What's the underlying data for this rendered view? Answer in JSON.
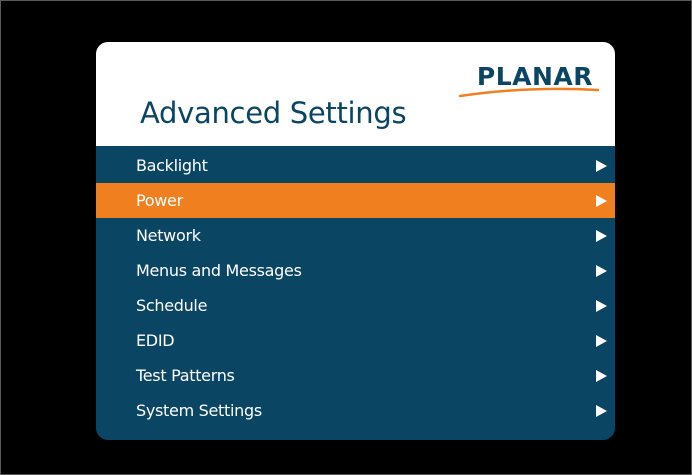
{
  "brand": {
    "logo_text": "PLANAR",
    "logo_color": "#0b4564",
    "swoosh_color": "#f07f1f"
  },
  "screen": {
    "title": "Advanced Settings"
  },
  "colors": {
    "background": "#000000",
    "menu_bg": "#0b4564",
    "selected_bg": "#f07f1f",
    "text": "#ffffff"
  },
  "menu": {
    "selected_index": 1,
    "items": [
      {
        "label": "Backlight",
        "icon": "chevron-right-icon"
      },
      {
        "label": "Power",
        "icon": "chevron-right-icon"
      },
      {
        "label": "Network",
        "icon": "chevron-right-icon"
      },
      {
        "label": "Menus and Messages",
        "icon": "chevron-right-icon"
      },
      {
        "label": "Schedule",
        "icon": "chevron-right-icon"
      },
      {
        "label": "EDID",
        "icon": "chevron-right-icon"
      },
      {
        "label": "Test Patterns",
        "icon": "chevron-right-icon"
      },
      {
        "label": "System Settings",
        "icon": "chevron-right-icon"
      }
    ]
  }
}
